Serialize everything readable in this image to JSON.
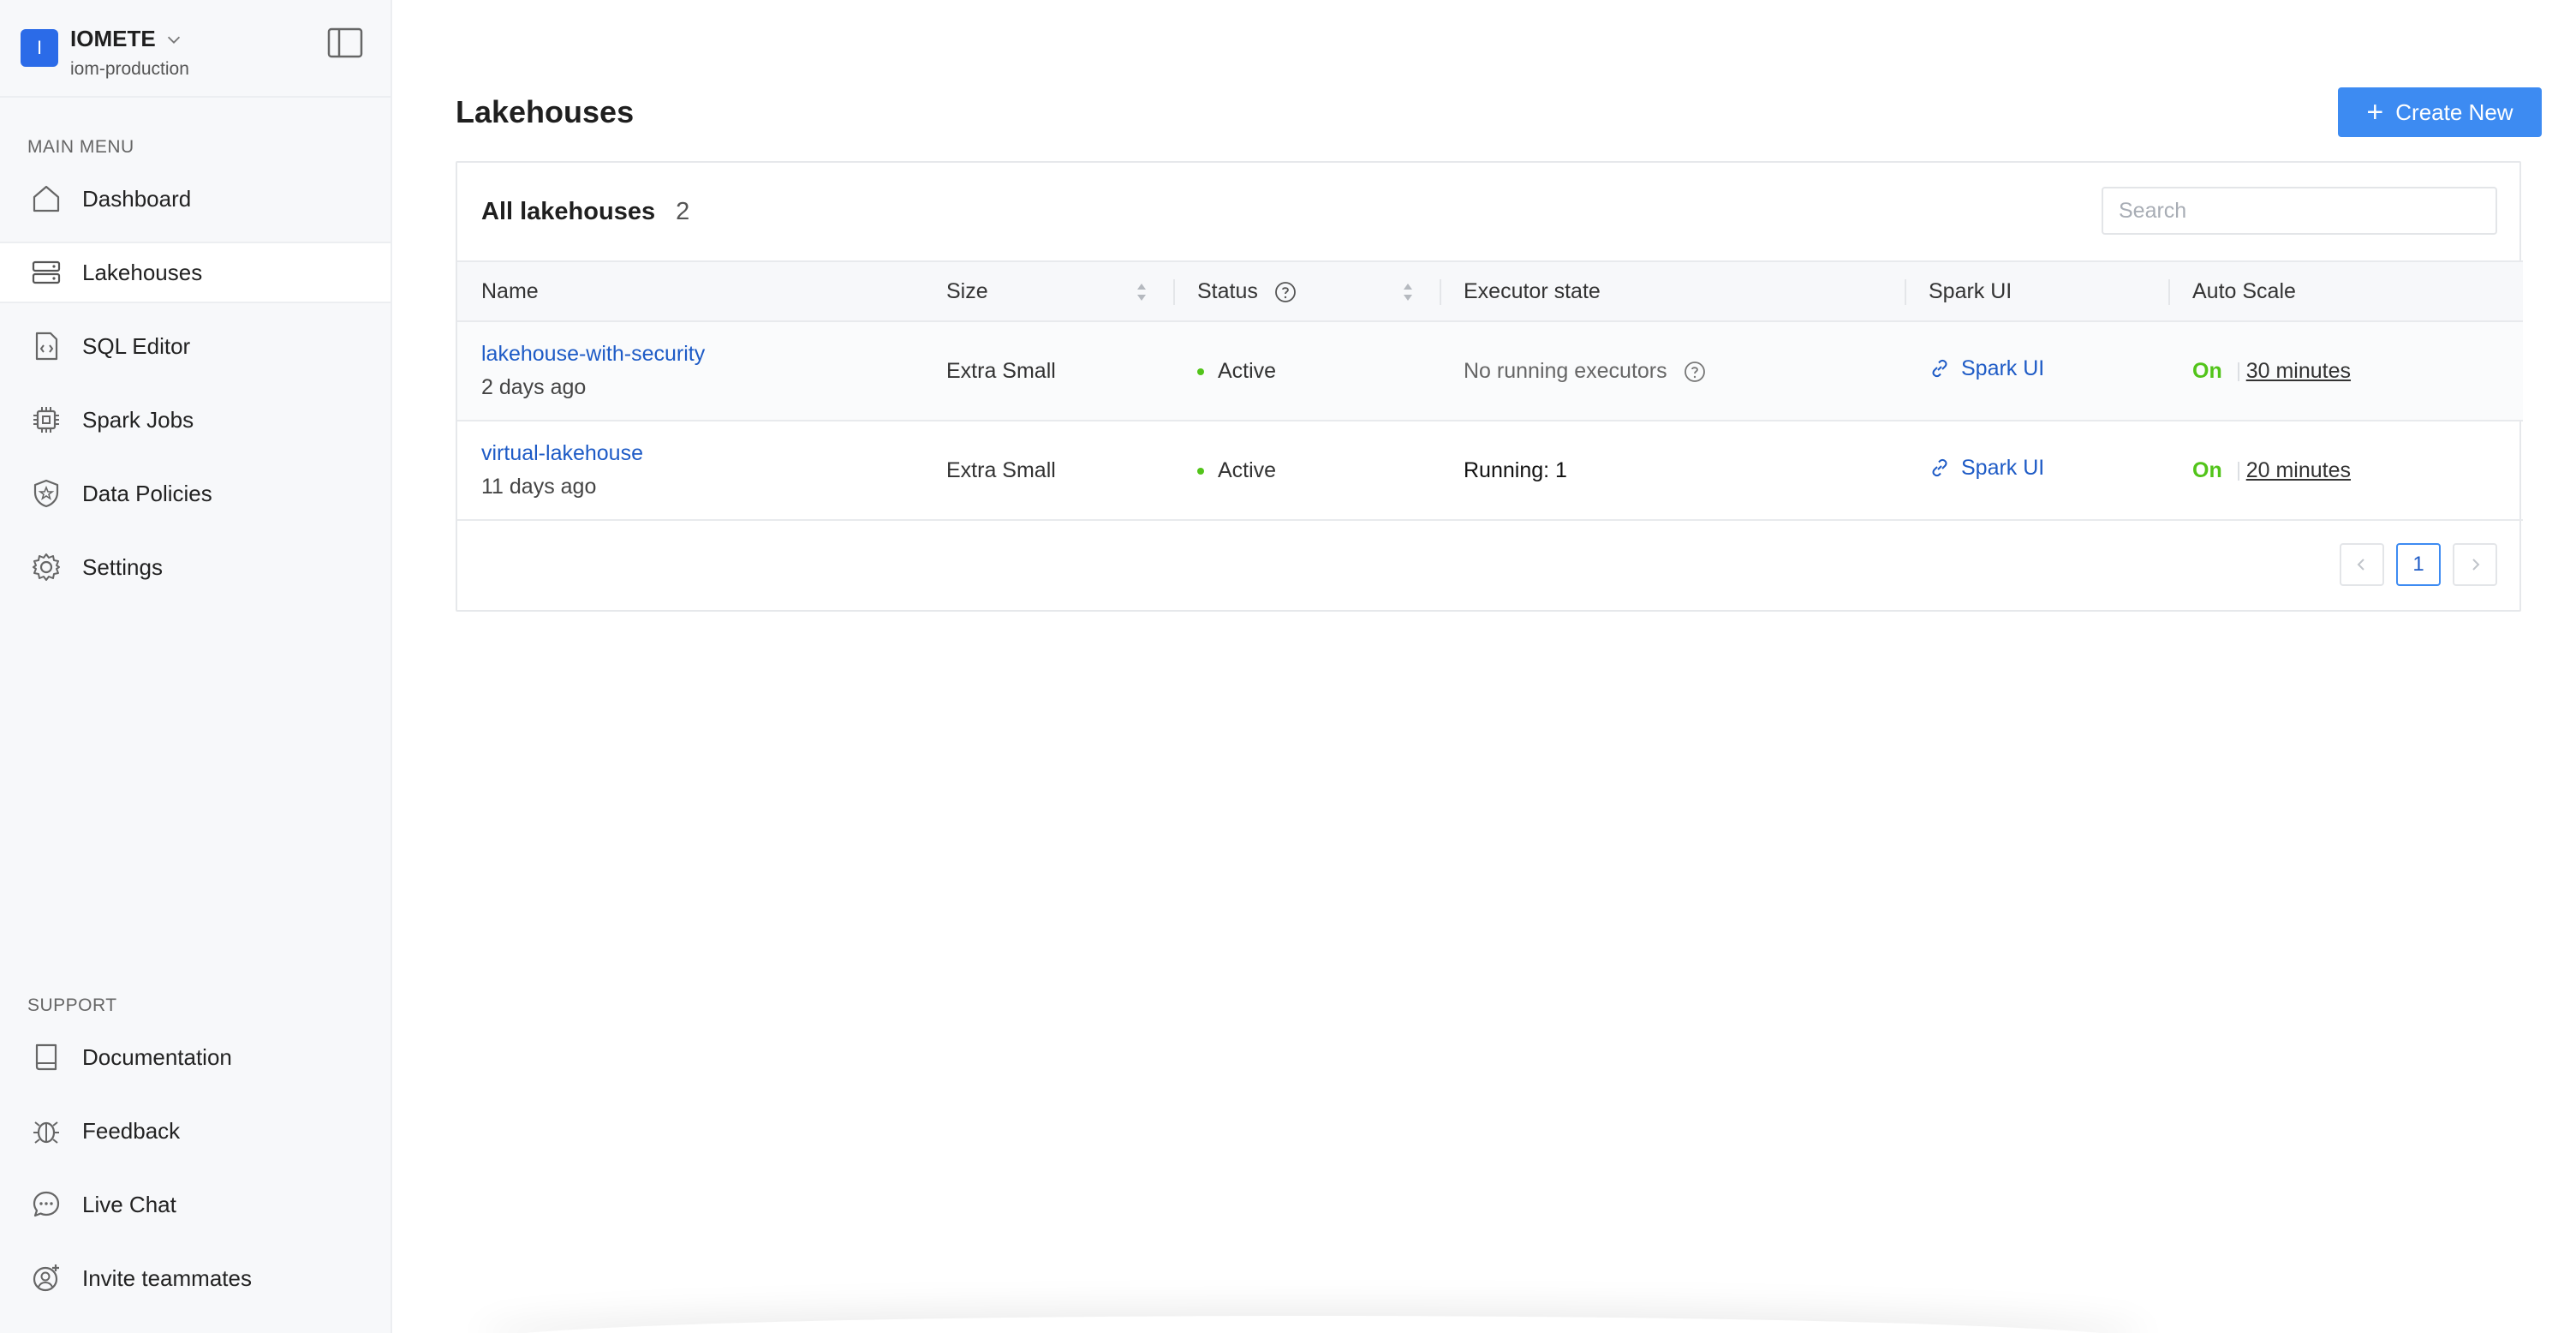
{
  "org": {
    "avatar_letter": "I",
    "name": "IOMETE",
    "environment": "iom-production"
  },
  "sidebar": {
    "main_title": "MAIN MENU",
    "main_items": [
      {
        "label": "Dashboard",
        "icon": "home-icon"
      },
      {
        "label": "Lakehouses",
        "icon": "server-icon",
        "active": true
      },
      {
        "label": "SQL Editor",
        "icon": "code-file-icon"
      },
      {
        "label": "Spark Jobs",
        "icon": "chip-icon"
      },
      {
        "label": "Data Policies",
        "icon": "shield-star-icon"
      },
      {
        "label": "Settings",
        "icon": "gear-icon"
      }
    ],
    "support_title": "SUPPORT",
    "support_items": [
      {
        "label": "Documentation",
        "icon": "book-icon"
      },
      {
        "label": "Feedback",
        "icon": "bug-icon"
      },
      {
        "label": "Live Chat",
        "icon": "chat-icon"
      },
      {
        "label": "Invite teammates",
        "icon": "user-add-icon"
      }
    ]
  },
  "page": {
    "title": "Lakehouses",
    "create_label": "Create New"
  },
  "card": {
    "title": "All lakehouses",
    "count": "2",
    "search_placeholder": "Search"
  },
  "table": {
    "columns": [
      "Name",
      "Size",
      "Status",
      "Executor state",
      "Spark UI",
      "Auto Scale"
    ],
    "rows": [
      {
        "name": "lakehouse-with-security",
        "age": "2 days ago",
        "size": "Extra Small",
        "status": "Active",
        "executor": "No running executors",
        "spark_ui": "Spark UI",
        "auto_scale": "On",
        "auto_scale_time": "30 minutes"
      },
      {
        "name": "virtual-lakehouse",
        "age": "11 days ago",
        "size": "Extra Small",
        "status": "Active",
        "executor": "Running: 1",
        "spark_ui": "Spark UI",
        "auto_scale": "On",
        "auto_scale_time": "20 minutes"
      }
    ]
  },
  "pagination": {
    "current": "1",
    "prev": "<",
    "next": ">"
  },
  "colors": {
    "accent": "#3d8bf2",
    "link": "#1e5bc6",
    "status_active": "#52c41a",
    "sidebar_bg": "#f7f8fa"
  }
}
